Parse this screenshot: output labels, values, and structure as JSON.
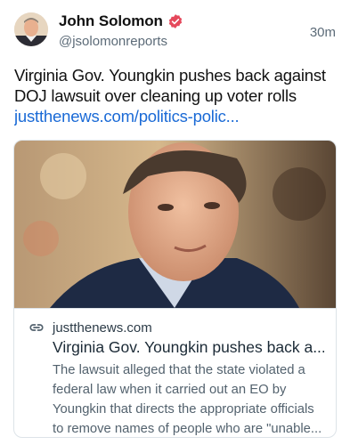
{
  "author": {
    "name": "John Solomon",
    "handle": "@jsolomonreports",
    "verified": true
  },
  "post": {
    "time": "30m",
    "text": "Virginia Gov. Youngkin pushes back against DOJ lawsuit over cleaning up voter rolls",
    "link_text": "justthenews.com/politics-polic..."
  },
  "link_card": {
    "domain": "justthenews.com",
    "title": "Virginia Gov. Youngkin pushes back a...",
    "description": "The lawsuit alleged that the state violated a federal law when it carried out an EO by Youngkin that directs the appropriate officials to remove names of people who are \"unable..."
  },
  "colors": {
    "link": "#1a6ad6",
    "verified_badge": "#e5485b",
    "secondary_text": "#5c6b78"
  },
  "icons": {
    "verified": "verified-badge-icon",
    "link": "link-icon"
  }
}
